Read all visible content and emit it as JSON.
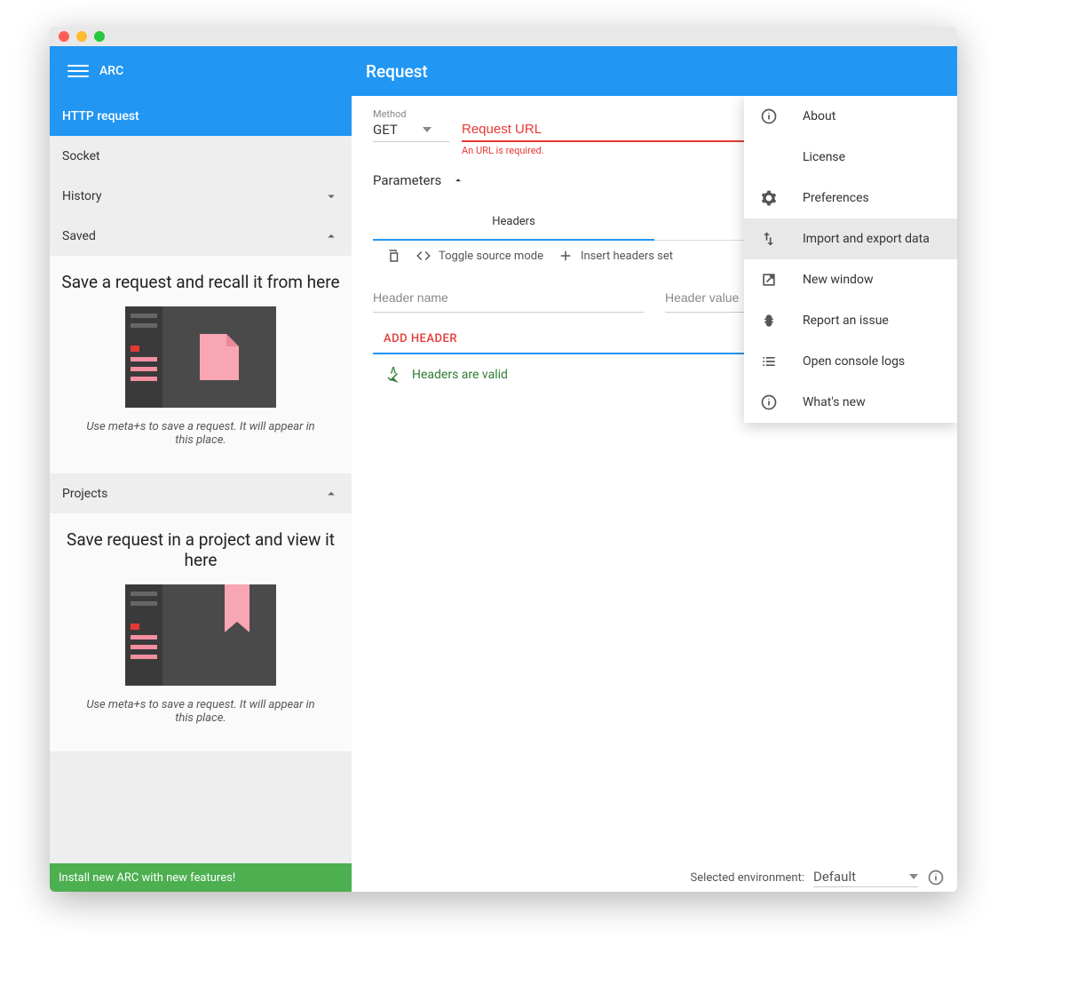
{
  "app": {
    "name": "ARC",
    "header_title": "Request"
  },
  "sidebar": {
    "nav": [
      {
        "label": "HTTP request",
        "active": true,
        "expand": null
      },
      {
        "label": "Socket",
        "active": false,
        "expand": null
      },
      {
        "label": "History",
        "active": false,
        "expand": "down"
      },
      {
        "label": "Saved",
        "active": false,
        "expand": "up"
      }
    ],
    "saved_panel": {
      "title": "Save a request and recall it from here",
      "hint": "Use meta+s to save a request. It will appear in this place."
    },
    "projects_label": "Projects",
    "projects_panel": {
      "title": "Save request in a project and view it here",
      "hint": "Use meta+s to save a request. It will appear in this place."
    }
  },
  "request": {
    "method_label": "Method",
    "method_value": "GET",
    "url_placeholder": "Request URL",
    "url_error": "An URL is required.",
    "params_label": "Parameters",
    "tabs": {
      "headers": "Headers"
    },
    "toolbar": {
      "toggle_source": "Toggle source mode",
      "insert_headers": "Insert headers set"
    },
    "header_name_placeholder": "Header name",
    "header_value_placeholder": "Header value",
    "add_header_label": "ADD HEADER",
    "valid_message": "Headers are valid"
  },
  "menu": {
    "items": [
      {
        "icon": "info",
        "label": "About"
      },
      {
        "icon": "",
        "label": "License"
      },
      {
        "icon": "gear",
        "label": "Preferences"
      },
      {
        "icon": "import-export",
        "label": "Import and export data",
        "hover": true
      },
      {
        "icon": "open-new",
        "label": "New window"
      },
      {
        "icon": "bug",
        "label": "Report an issue"
      },
      {
        "icon": "list",
        "label": "Open console logs"
      },
      {
        "icon": "info",
        "label": "What's new"
      }
    ]
  },
  "status": {
    "install_msg": "Install new ARC with new features!",
    "env_label": "Selected environment:",
    "env_value": "Default"
  }
}
